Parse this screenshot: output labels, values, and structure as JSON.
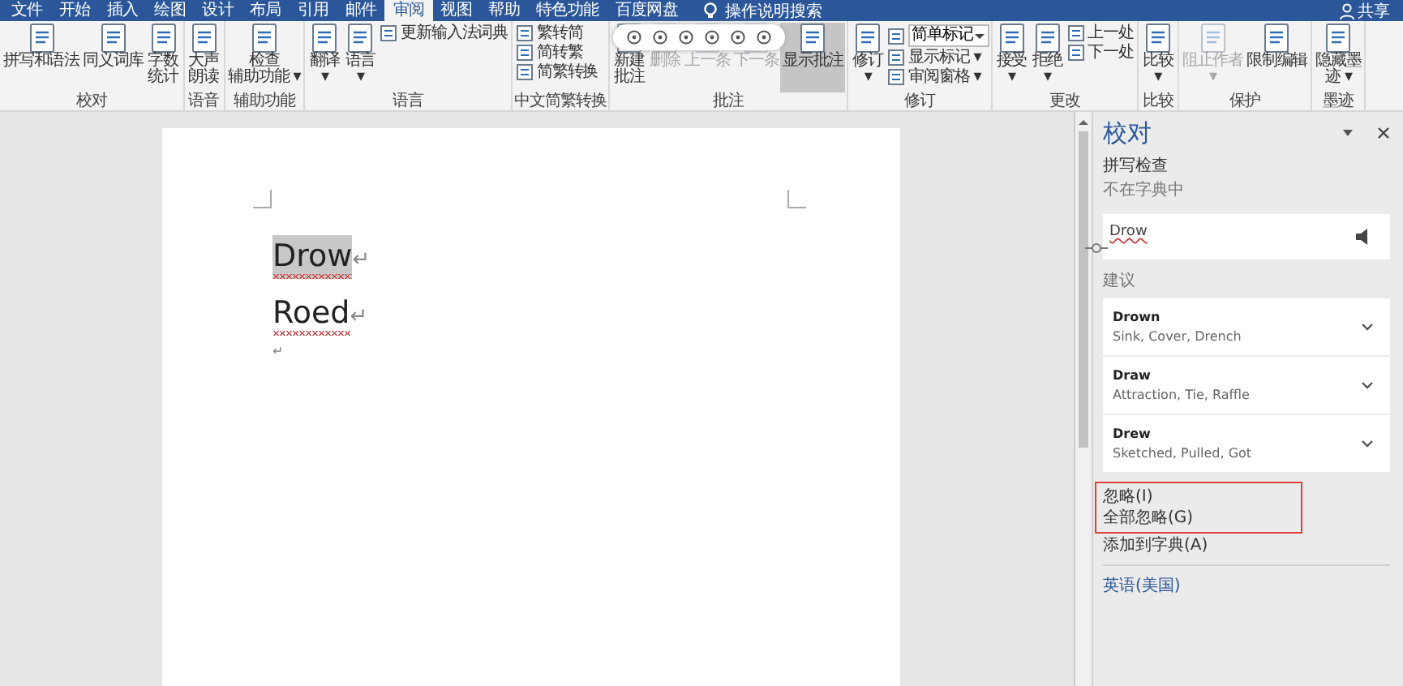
{
  "tabs": [
    {
      "label": "文件",
      "selected": false
    },
    {
      "label": "开始",
      "selected": false
    },
    {
      "label": "插入",
      "selected": false
    },
    {
      "label": "绘图",
      "selected": false
    },
    {
      "label": "设计",
      "selected": false
    },
    {
      "label": "布局",
      "selected": false
    },
    {
      "label": "引用",
      "selected": false
    },
    {
      "label": "邮件",
      "selected": false
    },
    {
      "label": "审阅",
      "selected": true
    },
    {
      "label": "视图",
      "selected": false
    },
    {
      "label": "帮助",
      "selected": false
    },
    {
      "label": "特色功能",
      "selected": false
    },
    {
      "label": "百度网盘",
      "selected": false
    }
  ],
  "tell_me": "操作说明搜索",
  "share": "共享",
  "ribbon": [
    {
      "label": "校对",
      "items": [
        {
          "kind": "large",
          "lines": [
            "拼写和语法"
          ]
        },
        {
          "kind": "large",
          "lines": [
            "同义词库"
          ]
        },
        {
          "kind": "large",
          "lines": [
            "字数",
            "统计"
          ]
        }
      ]
    },
    {
      "label": "语音",
      "items": [
        {
          "kind": "large",
          "lines": [
            "大声",
            "朗读"
          ]
        }
      ]
    },
    {
      "label": "辅助功能",
      "items": [
        {
          "kind": "large",
          "lines": [
            "检查",
            "辅助功能 ▾"
          ]
        }
      ]
    },
    {
      "label": "语言",
      "items": [
        {
          "kind": "large",
          "lines": [
            "翻译",
            "▾"
          ]
        },
        {
          "kind": "large",
          "lines": [
            "语言",
            "▾"
          ]
        },
        {
          "kind": "small",
          "label": "更新输入法词典"
        }
      ]
    },
    {
      "label": "中文简繁转换",
      "items": [
        {
          "kind": "small",
          "label": "繁转简"
        },
        {
          "kind": "small",
          "label": "简转繁"
        },
        {
          "kind": "small",
          "label": "简繁转换"
        }
      ]
    },
    {
      "label": "批注",
      "items": [
        {
          "kind": "large",
          "lines": [
            "新建",
            "批注"
          ]
        },
        {
          "kind": "large",
          "lines": [
            "删除"
          ],
          "disabled": true
        },
        {
          "kind": "large",
          "lines": [
            "上一条"
          ],
          "disabled": true
        },
        {
          "kind": "large",
          "lines": [
            "下一条"
          ],
          "disabled": true
        },
        {
          "kind": "large",
          "lines": [
            "显示批注"
          ],
          "selected": true
        }
      ]
    },
    {
      "label": "修订",
      "items": [
        {
          "kind": "large",
          "lines": [
            "修订",
            "▾"
          ]
        },
        {
          "kind": "dropdown",
          "label": "简单标记"
        },
        {
          "kind": "small",
          "label": "显示标记 ▾"
        },
        {
          "kind": "small",
          "label": "审阅窗格 ▾"
        }
      ]
    },
    {
      "label": "更改",
      "items": [
        {
          "kind": "large",
          "lines": [
            "接受",
            "▾"
          ]
        },
        {
          "kind": "large",
          "lines": [
            "拒绝",
            "▾"
          ]
        },
        {
          "kind": "small",
          "label": "上一处"
        },
        {
          "kind": "small",
          "label": "下一处"
        }
      ]
    },
    {
      "label": "比较",
      "items": [
        {
          "kind": "large",
          "lines": [
            "比较",
            "▾"
          ]
        }
      ]
    },
    {
      "label": "保护",
      "items": [
        {
          "kind": "large",
          "lines": [
            "阻止作者",
            "▾"
          ],
          "disabled": true
        },
        {
          "kind": "large",
          "lines": [
            "限制编辑"
          ]
        }
      ]
    },
    {
      "label": "墨迹",
      "items": [
        {
          "kind": "large",
          "lines": [
            "隐藏墨",
            "迹 ▾"
          ]
        }
      ]
    }
  ],
  "document": {
    "paragraphs": [
      {
        "text": "Drow",
        "mark": "↵",
        "misspelled": true,
        "selected": true
      },
      {
        "text": "Roed",
        "mark": "↵",
        "misspelled": true,
        "selected": false
      },
      {
        "mark": "↵"
      }
    ]
  },
  "pane": {
    "title": "校对",
    "section": "拼写检查",
    "status": "不在字典中",
    "word": "Drow",
    "suggestions_label": "建议",
    "suggestions": [
      {
        "word": "Drown",
        "synonyms": "Sink, Cover, Drench"
      },
      {
        "word": "Draw",
        "synonyms": "Attraction, Tie, Raffle"
      },
      {
        "word": "Drew",
        "synonyms": "Sketched, Pulled, Got"
      }
    ],
    "actions": [
      {
        "label": "忽略(I)",
        "highlighted": true
      },
      {
        "label": "全部忽略(G)",
        "highlighted": true
      },
      {
        "label": "添加到字典(A)",
        "highlighted": false
      }
    ],
    "language": "英语(美国)"
  }
}
